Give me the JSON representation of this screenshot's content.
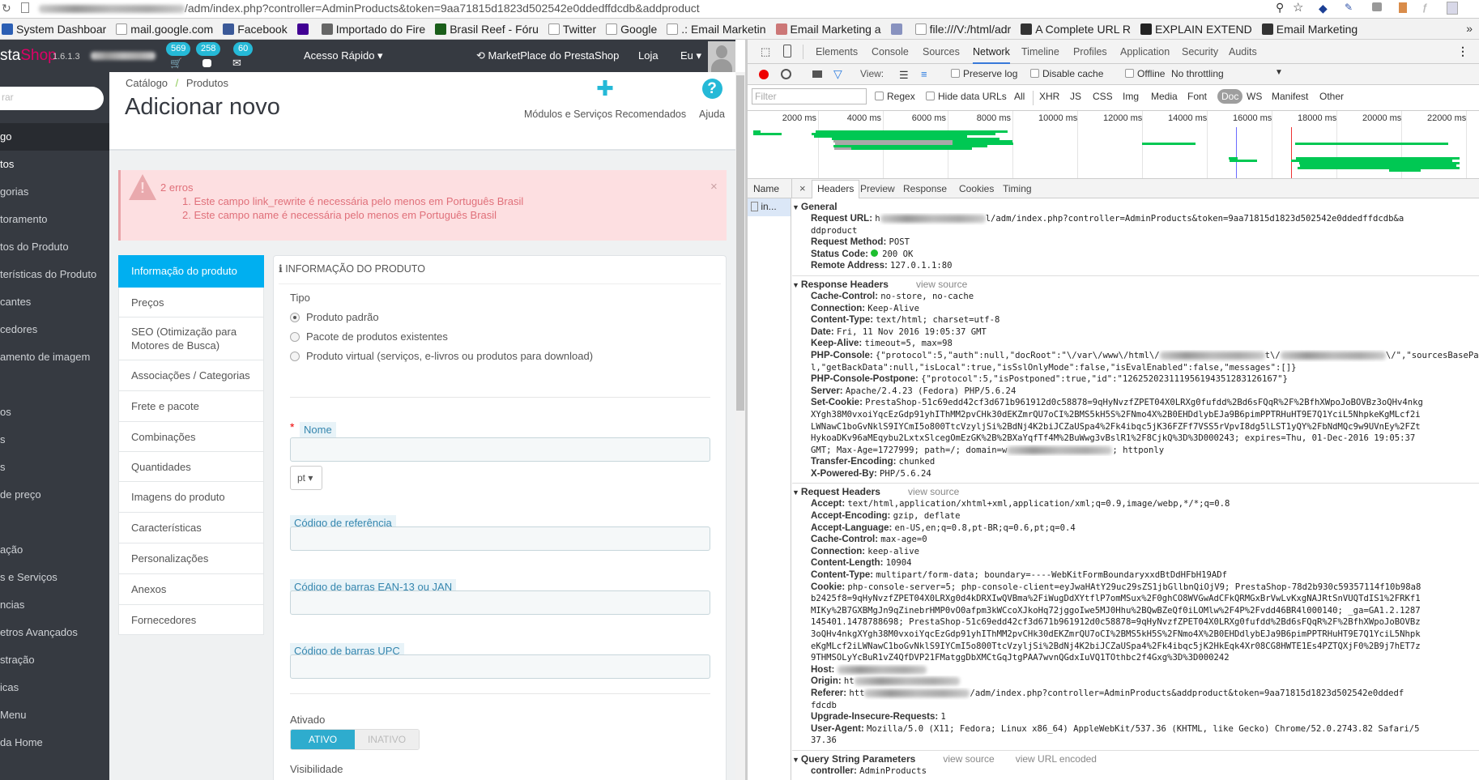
{
  "browser": {
    "url_suffix": "/adm/index.php?controller=AdminProducts&token=9aa71815d1823d502542e0ddedffdcdb&addproduct",
    "bookmarks": [
      "System Dashboar",
      "mail.google.com",
      "Facebook",
      "",
      "Importado do Fire",
      "Brasil Reef - Fóru",
      "Twitter",
      "Google",
      ".: Email Marketin",
      "Email Marketing a",
      "",
      "file:///V:/html/adr",
      "A Complete URL R",
      "EXPLAIN EXTEND",
      "Email Marketing"
    ],
    "more": "»"
  },
  "ps": {
    "logo_prefix": "sta",
    "logo_suffix": "Shop",
    "version": "1.6.1.3",
    "badges": {
      "orders": "569",
      "customers": "258",
      "messages": "60"
    },
    "quick_access": "Acesso Rápido ▾",
    "marketplace": "MarketPlace do PrestaShop",
    "shop": "Loja",
    "me": "Eu ▾",
    "search_placeholder": "rar",
    "sidebar": [
      "go",
      "tos",
      "gorias",
      "toramento",
      "tos do Produto",
      "terísticas do Produto",
      "cantes",
      "cedores",
      "amento de imagem",
      "",
      "os",
      "s",
      "s",
      "de preço",
      "",
      "ação",
      "s e Serviços",
      "ncias",
      "etros Avançados",
      "stração",
      "icas",
      "Menu",
      "da Home"
    ],
    "breadcrumb": {
      "parent": "Catálogo",
      "sep": "/",
      "current": "Produtos"
    },
    "title": "Adicionar novo",
    "toolbar": {
      "modules": "Módulos e Serviços Recomendados",
      "help": "Ajuda"
    },
    "alert": {
      "title": "2 erros",
      "errors": [
        "1. Este campo link_rewrite é necessária pelo menos em Português Brasil",
        "2. Este campo name é necessária pelo menos em Português Brasil"
      ],
      "close": "×"
    },
    "tabs": [
      "Informação do produto",
      "Preços",
      "SEO (Otimização para Motores de Busca)",
      "Associações / Categorias",
      "Frete e pacote",
      "Combinações",
      "Quantidades",
      "Imagens do produto",
      "Características",
      "Personalizações",
      "Anexos",
      "Fornecedores"
    ],
    "panel": {
      "heading": "INFORMAÇÃO DO PRODUTO",
      "type_label": "Tipo",
      "types": [
        "Produto padrão",
        "Pacote de produtos existentes",
        "Produto virtual (serviços, e-livros ou produtos para download)"
      ],
      "selected_type": 0,
      "name_required": "*",
      "name_label": "Nome",
      "name_value": "",
      "lang": "pt ▾",
      "reference_label": "Código de referência",
      "reference_value": "",
      "ean_label": "Código de barras EAN-13 ou JAN",
      "ean_value": "",
      "upc_label": "Código de barras UPC",
      "upc_value": "",
      "active_label": "Ativado",
      "active_on": "ATIVO",
      "active_off": "INATIVO",
      "active": true,
      "visibility_label": "Visibilidade"
    },
    "colors": {
      "accent": "#00aff0",
      "switch": "#2eacce",
      "dark": "#363a41",
      "error": "#e0707a"
    }
  },
  "devtools": {
    "tabs": [
      "Elements",
      "Console",
      "Sources",
      "Network",
      "Timeline",
      "Profiles",
      "Application",
      "Security",
      "Audits"
    ],
    "active_tab": "Network",
    "view_label": "View:",
    "preserve_log": "Preserve log",
    "disable_cache": "Disable cache",
    "offline": "Offline",
    "throttling": "No throttling",
    "filter_placeholder": "Filter",
    "regex": "Regex",
    "hide_data_urls": "Hide data URLs",
    "types": [
      "All",
      "XHR",
      "JS",
      "CSS",
      "Img",
      "Media",
      "Font",
      "Doc",
      "WS",
      "Manifest",
      "Other"
    ],
    "active_type": "Doc",
    "timeline": {
      "ticks_ms": [
        2000,
        4000,
        6000,
        8000,
        10000,
        12000,
        14000,
        16000,
        18000,
        20000,
        22000
      ],
      "tick_suffix": " ms",
      "dom_content_loaded_ms": 14900,
      "load_ms": 16600,
      "requests": [
        {
          "start": 0,
          "end": 230,
          "row": 0
        },
        {
          "start": 1920,
          "end": 7850,
          "row": 0
        },
        {
          "start": 0,
          "end": 880,
          "row": 1
        },
        {
          "start": 1800,
          "end": 7480,
          "row": 1
        },
        {
          "start": 1880,
          "end": 6590,
          "row": 2
        },
        {
          "start": 2430,
          "end": 7600,
          "row": 3
        },
        {
          "start": 2480,
          "wait_end": 6140,
          "end": 7990,
          "row": 4
        },
        {
          "start": 2530,
          "wait_end": 6140,
          "end": 8030,
          "row": 5
        },
        {
          "start": 11990,
          "end": 13650,
          "row": 5
        },
        {
          "start": 16730,
          "end": 21440,
          "row": 5
        },
        {
          "start": 2470,
          "end": 7220,
          "row": 6
        },
        {
          "start": 2500,
          "wait_end": 3030,
          "end": 6760,
          "row": 7
        },
        {
          "start": 14680,
          "end": 14950,
          "row": 11
        },
        {
          "start": 16760,
          "end": 21790,
          "row": 11
        },
        {
          "start": 14700,
          "end": 15550,
          "row": 12
        },
        {
          "start": 16600,
          "end": 21570,
          "row": 12
        },
        {
          "start": 16850,
          "end": 21790,
          "row": 13
        },
        {
          "start": 16880,
          "end": 21700,
          "row": 14
        },
        {
          "start": 16800,
          "end": 21790,
          "row": 15
        },
        {
          "start": 19620,
          "end": 20600,
          "row": 16
        }
      ]
    },
    "name_header": "Name",
    "request_name": "in...",
    "detail_close": "×",
    "detail_tabs": [
      "Headers",
      "Preview",
      "Response",
      "Cookies",
      "Timing"
    ],
    "status_color": "#1dbf2f",
    "sections": [
      {
        "title": "General",
        "links": [],
        "rows": [
          {
            "key": "Request URL:",
            "lines": [
              [
                "h",
                null,
                "l/adm/index.php?controller=AdminProducts&token=9aa71815d1823d502542e0ddedffdcdb&a"
              ],
              [
                "ddproduct"
              ]
            ]
          },
          {
            "key": "Request Method:",
            "lines": [
              [
                "POST"
              ]
            ]
          },
          {
            "key": "Status Code:",
            "status_dot": true,
            "lines": [
              [
                "200 OK"
              ]
            ]
          },
          {
            "key": "Remote Address:",
            "lines": [
              [
                "127.0.1.1:80"
              ]
            ]
          }
        ]
      },
      {
        "title": "Response Headers",
        "links": [
          "view source"
        ],
        "rows": [
          {
            "key": "Cache-Control:",
            "lines": [
              [
                "no-store, no-cache"
              ]
            ]
          },
          {
            "key": "Connection:",
            "lines": [
              [
                "Keep-Alive"
              ]
            ]
          },
          {
            "key": "Content-Type:",
            "lines": [
              [
                "text/html; charset=utf-8"
              ]
            ]
          },
          {
            "key": "Date:",
            "lines": [
              [
                "Fri, 11 Nov 2016 19:05:37 GMT"
              ]
            ]
          },
          {
            "key": "Keep-Alive:",
            "lines": [
              [
                "timeout=5, max=98"
              ]
            ]
          },
          {
            "key": "PHP-Console:",
            "lines": [
              [
                "{\"protocol\":5,\"auth\":null,\"docRoot\":\"\\/var\\/www\\/html\\/",
                null,
                "t\\/",
                null,
                "\\/\",\"sourcesBasePath\":nul"
              ],
              [
                "l,\"getBackData\":null,\"isLocal\":true,\"isSslOnlyMode\":false,\"isEvalEnabled\":false,\"messages\":[]}"
              ]
            ]
          },
          {
            "key": "PHP-Console-Postpone:",
            "lines": [
              [
                "{\"protocol\":5,\"isPostponed\":true,\"id\":\"126252023111956194351283126167\"}"
              ]
            ]
          },
          {
            "key": "Server:",
            "lines": [
              [
                "Apache/2.4.23 (Fedora) PHP/5.6.24"
              ]
            ]
          },
          {
            "key": "Set-Cookie:",
            "lines": [
              [
                "PrestaShop-51c69edd42cf3d671b961912d0c58878=9qHyNvzfZPET04X0LRXg0fufdd%2Bd6sFQqR%2F%2BfhXWpoJoBOVBz3oQHv4nkg"
              ],
              [
                "XYgh38M0vxoiYqcEzGdp91yhIThMM2pvCHk30dEKZmrQU7oCI%2BMS5kH5S%2FNmo4X%2B0EHDdlybEJa9B6pimPPTRHuHT9E7Q1YciL5NhpkeKgMLcf2i"
              ],
              [
                "LWNawC1boGvNklS9IYCmI5o800TtcVzyljSi%2BdNj4K2biJCZaUSpa4%2Fk4ibqc5jK36FZFf7VSS5rVpvI8dg5lLST1yQY%2FbNdMQc9w9UVnEy%2FZt"
              ],
              [
                "HykoaDKv96aMEqybu2LxtxSlcegOmEzGK%2B%2BXaYqfTf4M%2BuWwg3vBslR1%2F8CjkQ%3D%3D000243; expires=Thu, 01-Dec-2016 19:05:37"
              ],
              [
                " GMT; Max-Age=1727999; path=/; domain=w",
                null,
                "; httponly"
              ]
            ]
          },
          {
            "key": "Transfer-Encoding:",
            "lines": [
              [
                "chunked"
              ]
            ]
          },
          {
            "key": "X-Powered-By:",
            "lines": [
              [
                "PHP/5.6.24"
              ]
            ]
          }
        ]
      },
      {
        "title": "Request Headers",
        "links": [
          "view source"
        ],
        "rows": [
          {
            "key": "Accept:",
            "lines": [
              [
                "text/html,application/xhtml+xml,application/xml;q=0.9,image/webp,*/*;q=0.8"
              ]
            ]
          },
          {
            "key": "Accept-Encoding:",
            "lines": [
              [
                "gzip, deflate"
              ]
            ]
          },
          {
            "key": "Accept-Language:",
            "lines": [
              [
                "en-US,en;q=0.8,pt-BR;q=0.6,pt;q=0.4"
              ]
            ]
          },
          {
            "key": "Cache-Control:",
            "lines": [
              [
                "max-age=0"
              ]
            ]
          },
          {
            "key": "Connection:",
            "lines": [
              [
                "keep-alive"
              ]
            ]
          },
          {
            "key": "Content-Length:",
            "lines": [
              [
                "10904"
              ]
            ]
          },
          {
            "key": "Content-Type:",
            "lines": [
              [
                "multipart/form-data; boundary=----WebKitFormBoundaryxxdBtDdHFbH19ADf"
              ]
            ]
          },
          {
            "key": "Cookie:",
            "lines": [
              [
                "php-console-server=5; php-console-client=eyJwaHAtY29uc29sZS1jbGllbnQiOjV9; PrestaShop-78d2b930c59357114f10b98a8"
              ],
              [
                "b2425f8=9qHyNvzfZPET04X0LRXg0d4kDRXIwQVBma%2FiWugDdXYtflP7omMSux%2F0ghCO8WVGwAdCFkQRMGxBrVwLvKxgNAJRtSnVUQTdIS1%2FRKf1"
              ],
              [
                "MIKy%2B7GXBMgJn9qZinebrHMP0vO0afpm3kWCcoXJkoHq72jggoIwe5MJ0Hhu%2BQwBZeQf0iLOMlw%2F4P%2Fvdd46BR4l000140; _ga=GA1.2.1287"
              ],
              [
                "145401.1478788698; PrestaShop-51c69edd42cf3d671b961912d0c58878=9qHyNvzfZPET04X0LRXg0fufdd%2Bd6sFQqR%2F%2BfhXWpoJoBOVBz"
              ],
              [
                "3oQHv4nkgXYgh38M0vxoiYqcEzGdp91yhIThMM2pvCHk30dEKZmrQU7oCI%2BMS5kH5S%2FNmo4X%2B0EHDdlybEJa9B6pimPPTRHuHT9E7Q1YciL5Nhpk"
              ],
              [
                "eKgMLcf2iLWNawC1boGvNklS9IYCmI5o800TtcVzyljSi%2BdNj4K2biJCZaUSpa4%2Fk4ibqc5jK2HkEqk4Xr08CG8HWTE1Es4PZTQXjF0%2B9j7hET7z"
              ],
              [
                "9THMSOLyYcBuR1vZ4QfDVP21FMatggDbXMCtGqJtgPAA7wvnQGdxIuVQ1TOthbc2f4Gxg%3D%3D000242"
              ]
            ]
          },
          {
            "key": "Host:",
            "lines": [
              [
                null
              ]
            ]
          },
          {
            "key": "Origin:",
            "lines": [
              [
                "ht",
                null
              ]
            ]
          },
          {
            "key": "Referer:",
            "lines": [
              [
                "htt",
                null,
                "/adm/index.php?controller=AdminProducts&addproduct&token=9aa71815d1823d502542e0ddedf"
              ],
              [
                "fdcdb"
              ]
            ]
          },
          {
            "key": "Upgrade-Insecure-Requests:",
            "lines": [
              [
                "1"
              ]
            ]
          },
          {
            "key": "User-Agent:",
            "lines": [
              [
                "Mozilla/5.0 (X11; Fedora; Linux x86_64) AppleWebKit/537.36 (KHTML, like Gecko) Chrome/52.0.2743.82 Safari/5"
              ],
              [
                "37.36"
              ]
            ]
          }
        ]
      },
      {
        "title": "Query String Parameters",
        "links": [
          "view source",
          "view URL encoded"
        ],
        "rows": [
          {
            "key": "controller:",
            "lines": [
              [
                "AdminProducts"
              ]
            ]
          }
        ]
      }
    ]
  }
}
